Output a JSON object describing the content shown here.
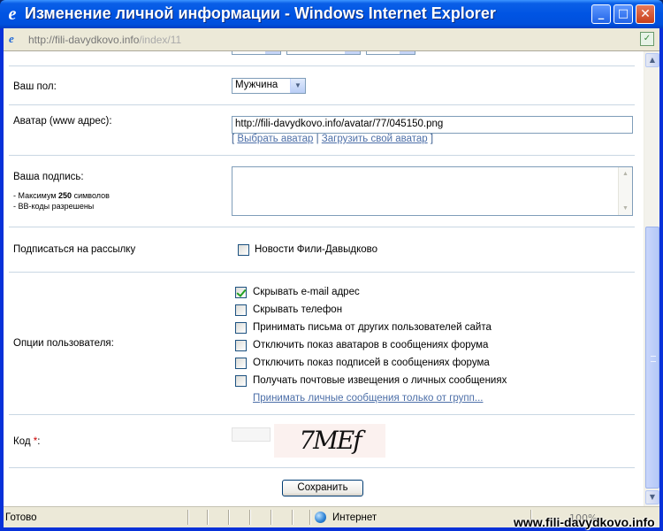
{
  "window": {
    "title": "Изменение личной информации - Windows Internet Explorer",
    "minimize": "_",
    "maximize": "□",
    "close": "✕"
  },
  "address": {
    "host": "http://fili-davydkovo.info",
    "path": "/index/11"
  },
  "form": {
    "gender": {
      "label": "Ваш пол:",
      "value": "Мужчина"
    },
    "avatar": {
      "label": "Аватар (www адрес):",
      "value": "http://fili-davydkovo.info/avatar/77/045150.png",
      "open_bracket": "[",
      "choose_link": "Выбрать аватар",
      "divider": "|",
      "upload_link": "Загрузить свой аватар",
      "close_bracket": "]"
    },
    "signature": {
      "label": "Ваша подпись:",
      "hint_max_prefix": "- Максимум ",
      "hint_max_count": "250",
      "hint_max_suffix": " символов",
      "hint_bb": "- BB-коды разрешены"
    },
    "newsletter": {
      "label": "Подписаться на рассылку",
      "option": {
        "label": "Новости Фили-Давыдково",
        "checked": false
      }
    },
    "user_options": {
      "label": "Опции пользователя:",
      "options": [
        {
          "label": "Скрывать e-mail адрес",
          "checked": true
        },
        {
          "label": "Скрывать телефон",
          "checked": false
        },
        {
          "label": "Принимать письма от других пользователей сайта",
          "checked": false
        },
        {
          "label": "Отключить показ аватаров в сообщениях форума",
          "checked": false
        },
        {
          "label": "Отключить показ подписей в сообщениях форума",
          "checked": false
        },
        {
          "label": "Получать почтовые извещения о личных сообщениях",
          "checked": false
        }
      ],
      "groups_link": "Принимать личные сообщения только от групп..."
    },
    "code": {
      "label": "Код ",
      "required_mark": "*",
      "suffix": ":",
      "captcha_text": "7MEf"
    },
    "save_label": "Сохранить"
  },
  "status": {
    "text": "Готово",
    "zone": "Интернет",
    "zoom": "100%"
  },
  "watermark": "www.fili-davydkovo.info"
}
